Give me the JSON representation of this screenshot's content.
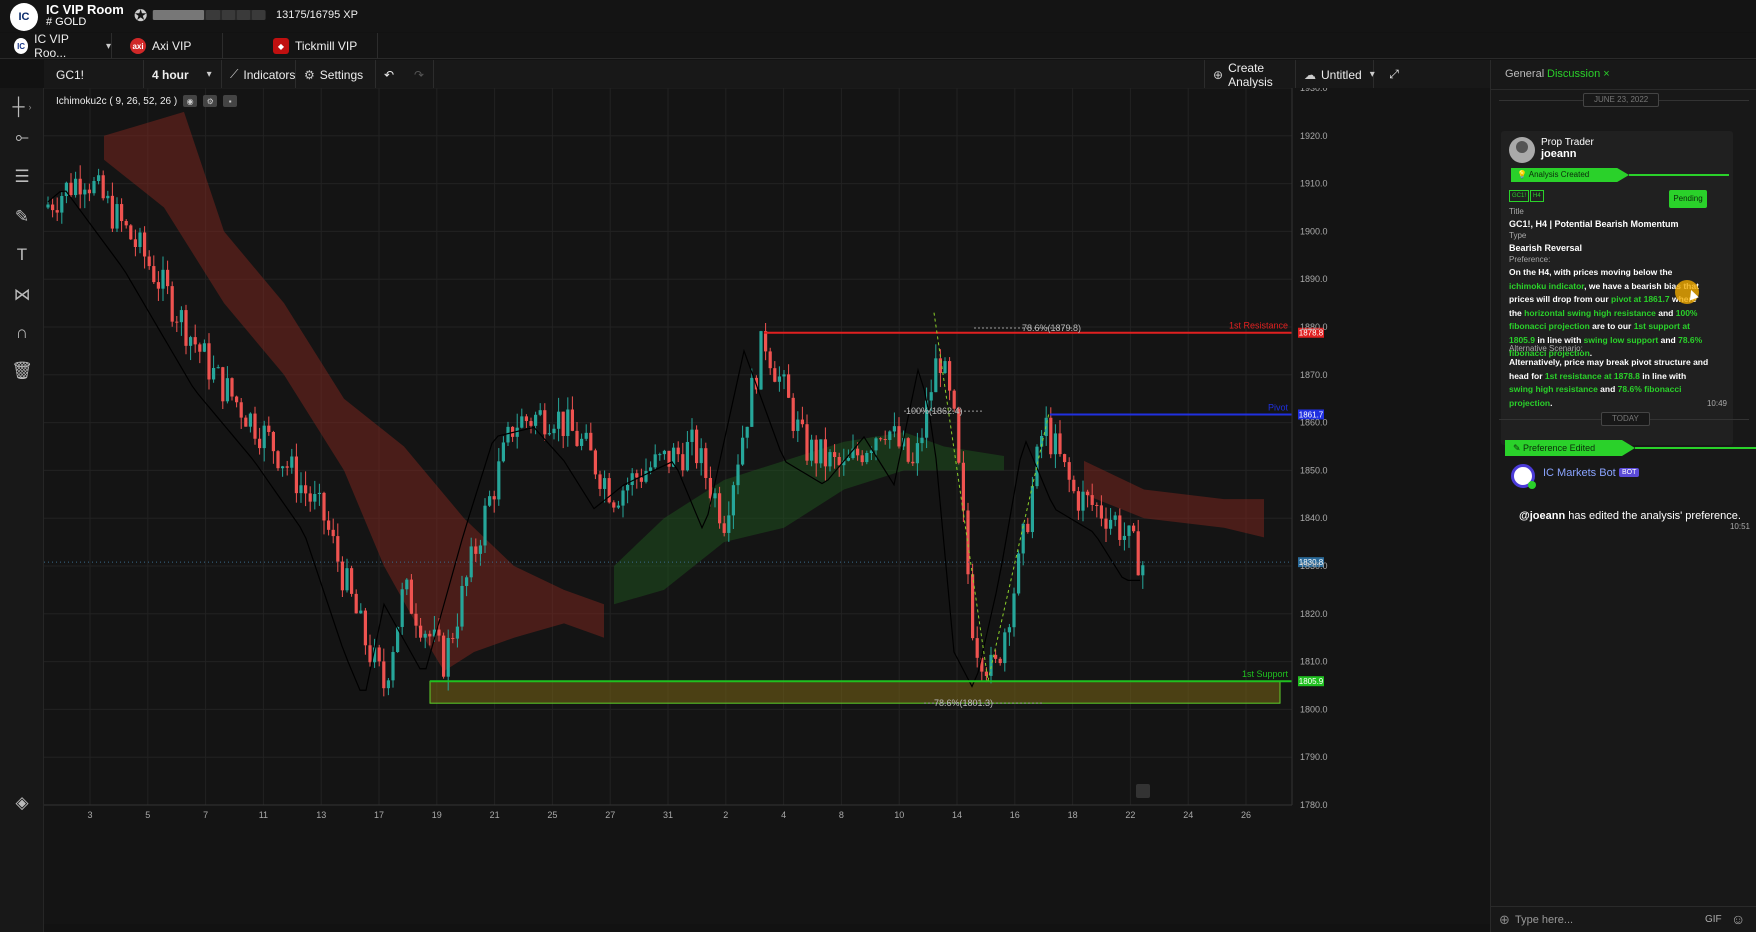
{
  "header": {
    "logo_text": "IC",
    "room_title": "IC VIP Room",
    "room_sub": "# GOLD",
    "xp_text": "13175/16795 XP",
    "xp_progress": 0.78
  },
  "tabs": [
    {
      "label": "IC VIP Roo...",
      "icon_color": "#1e3a8a"
    },
    {
      "label": "Axi VIP",
      "icon_color": "#d02828",
      "icon_text": "axi"
    },
    {
      "label": "Tickmill VIP",
      "icon_color": "#c01010"
    }
  ],
  "toolbar": {
    "symbol": "GC1!",
    "interval": "4 hour",
    "indicators": "Indicators",
    "settings": "Settings",
    "create": "Create Analysis",
    "untitled": "Untitled"
  },
  "indicator": {
    "label": "Ichimoku2c ( 9, 26, 52, 26 )"
  },
  "chart_data": {
    "type": "candlestick",
    "symbol": "GC1!",
    "interval": "4 hour",
    "ylim": [
      1780,
      1930
    ],
    "y_ticks": [
      "1930.0",
      "1920.0",
      "1910.0",
      "1900.0",
      "1890.0",
      "1880.0",
      "1870.0",
      "1860.0",
      "1850.0",
      "1840.0",
      "1830.0",
      "1820.0",
      "1810.0",
      "1800.0",
      "1790.0",
      "1780.0"
    ],
    "x_ticks": [
      "3",
      "5",
      "7",
      "11",
      "13",
      "17",
      "19",
      "21",
      "25",
      "27",
      "31",
      "2",
      "4",
      "8",
      "10",
      "14",
      "16",
      "18",
      "22",
      "24",
      "26"
    ],
    "levels": [
      {
        "name": "1st Resistance",
        "value": "1878.8",
        "color": "#e02020"
      },
      {
        "name": "Pivot",
        "value": "1861.7",
        "color": "#2030e0"
      },
      {
        "name": "1st Support",
        "value": "1805.9",
        "color": "#20c020"
      }
    ],
    "last_price": "1830.8",
    "fib_labels": [
      "78.6%(1879.8)",
      "100%(1862.4)",
      "78.6%(1801.3)"
    ]
  },
  "panel": {
    "tab_general": "General",
    "tab_discussion": "Discussion",
    "date1": "JUNE 23, 2022",
    "card": {
      "role": "Prop Trader",
      "user": "joeann",
      "banner": "Analysis Created",
      "tag1": "GC1!",
      "tag2": "H4",
      "status": "Pending",
      "title_label": "Title",
      "title": "GC1!, H4 | Potential Bearish Momentum",
      "type_label": "Type",
      "type": "Bearish Reversal",
      "pref_label": "Preference:",
      "pref_segments": [
        {
          "t": "On the H4, with prices moving below the ",
          "g": false
        },
        {
          "t": "ichimoku indicator",
          "g": true
        },
        {
          "t": ", we have a bearish bias that prices will drop from our ",
          "g": false
        },
        {
          "t": "pivot at 1861.7",
          "g": true
        },
        {
          "t": " where the ",
          "g": false
        },
        {
          "t": "horizontal swing high resistance",
          "g": true
        },
        {
          "t": " and ",
          "g": false
        },
        {
          "t": "100% fibonacci projection",
          "g": true
        },
        {
          "t": " are to our ",
          "g": false
        },
        {
          "t": "1st support  at 1805.9",
          "g": true
        },
        {
          "t": " in line with ",
          "g": false
        },
        {
          "t": "swing low support",
          "g": true
        },
        {
          "t": " and ",
          "g": false
        },
        {
          "t": "78.6% fibonacci projection",
          "g": true
        },
        {
          "t": ".",
          "g": false
        }
      ],
      "alt_label": "Alternative Scenario:",
      "alt_segments": [
        {
          "t": "Alternatively, price may break pivot structure and head for ",
          "g": false
        },
        {
          "t": "1st resistance at 1878.8",
          "g": true
        },
        {
          "t": " in line with ",
          "g": false
        },
        {
          "t": "swing high resistance",
          "g": true
        },
        {
          "t": " and ",
          "g": false
        },
        {
          "t": "78.6% fibonacci projection",
          "g": true
        },
        {
          "t": ".",
          "g": false
        }
      ],
      "time": "10:49"
    },
    "date2": "TODAY",
    "pe_banner": "Preference Edited",
    "bot_name": "IC Markets Bot",
    "bot_badge": "BOT",
    "bot_user": "@joeann",
    "bot_msg": " has edited the analysis' preference.",
    "bot_time": "10:51",
    "input_placeholder": "Type here...",
    "gif": "GIF"
  }
}
